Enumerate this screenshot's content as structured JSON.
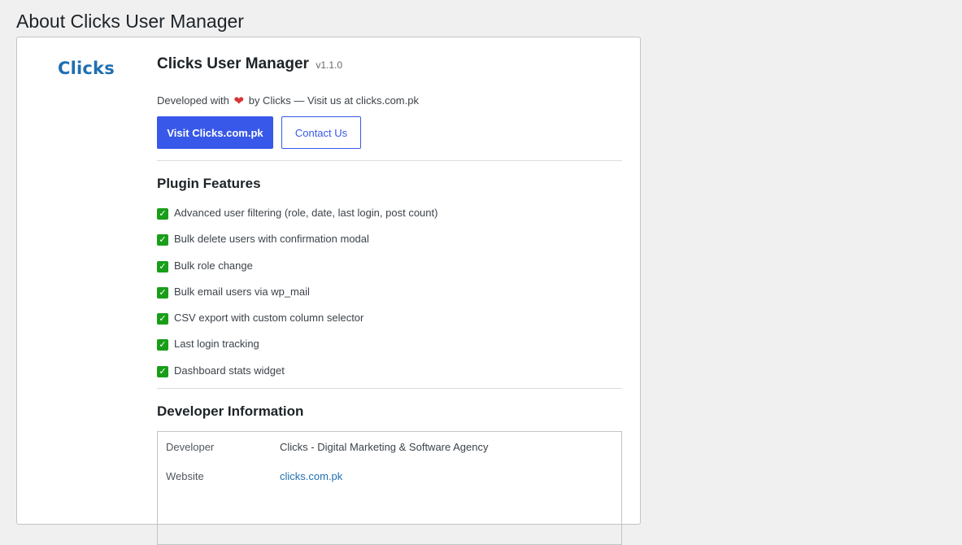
{
  "page": {
    "title": "About Clicks User Manager"
  },
  "brand": {
    "logo_text": "Clicks",
    "logo_color": "#1f6fb2",
    "accent_color": "#3858e9"
  },
  "plugin": {
    "name": "Clicks User Manager",
    "version": "v1.1.0",
    "tagline_prefix": "Developed with",
    "tagline_suffix": "by Clicks — Visit us at clicks.com.pk",
    "heart_icon": "heart-icon"
  },
  "actions": {
    "visit_label": "Visit Clicks.com.pk",
    "contact_label": "Contact Us"
  },
  "features": {
    "title": "Plugin Features",
    "items": [
      "Advanced user filtering (role, date, last login, post count)",
      "Bulk delete users with confirmation modal",
      "Bulk role change",
      "Bulk email users via wp_mail",
      "CSV export with custom column selector",
      "Last login tracking",
      "Dashboard stats widget"
    ]
  },
  "developer": {
    "title": "Developer Information",
    "rows": [
      {
        "label": "Developer",
        "value": "Clicks - Digital Marketing & Software Agency"
      },
      {
        "label": "Website",
        "value": "clicks.com.pk"
      }
    ]
  }
}
